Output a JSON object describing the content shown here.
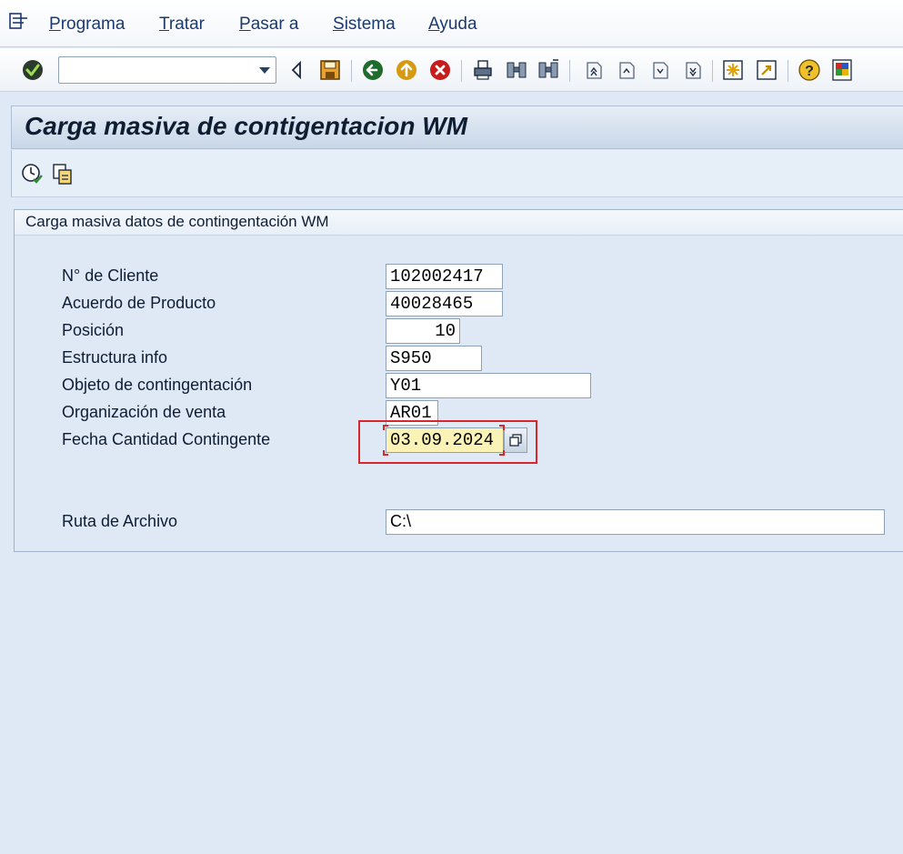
{
  "menu": {
    "items": [
      {
        "underline": "P",
        "rest": "rograma"
      },
      {
        "underline": "T",
        "rest": "ratar"
      },
      {
        "underline": "P",
        "rest": "asar a"
      },
      {
        "underline": "S",
        "rest": "istema"
      },
      {
        "underline": "A",
        "rest": "yuda"
      }
    ]
  },
  "toolbar": {
    "command_field_value": "",
    "icons": [
      "enter-icon",
      "back-arrow-icon",
      "save-icon",
      "back-icon",
      "exit-icon",
      "cancel-icon",
      "print-icon",
      "find-icon",
      "find-next-icon",
      "first-page-icon",
      "previous-page-icon",
      "next-page-icon",
      "last-page-icon",
      "create-session-icon",
      "shortcut-icon",
      "help-icon",
      "customize-layout-icon"
    ]
  },
  "title": "Carga masiva de contigentacion WM",
  "app_toolbar": {
    "icons": [
      "execute-icon",
      "copy-variant-icon"
    ]
  },
  "group": {
    "title": "Carga masiva datos de contingentación WM",
    "fields": {
      "cliente": {
        "label": "N° de Cliente",
        "value": "102002417"
      },
      "acuerdo": {
        "label": "Acuerdo de Producto",
        "value": "40028465"
      },
      "posicion": {
        "label": "Posición",
        "value": "10"
      },
      "estructura": {
        "label": "Estructura info",
        "value": "S950"
      },
      "objeto": {
        "label": "Objeto de contingentación",
        "value": "Y01"
      },
      "organizacion": {
        "label": "Organización de venta",
        "value": "AR01"
      },
      "fecha": {
        "label": "Fecha Cantidad Contingente",
        "value": "03.09.2024"
      },
      "ruta": {
        "label": "Ruta de Archivo",
        "value": "C:\\"
      }
    }
  },
  "colors": {
    "background": "#dfe9f5",
    "highlight": "#d9262c",
    "date_field": "#fbf3b6"
  }
}
